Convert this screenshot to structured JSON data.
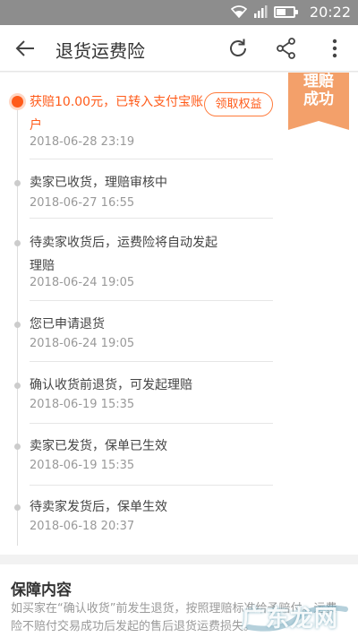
{
  "status_bar": {
    "time": "20:22",
    "battery_level": 0.55
  },
  "header": {
    "title": "退货运费险"
  },
  "ribbon": {
    "line1": "理赔",
    "line2": "成功"
  },
  "timeline": [
    {
      "text": "获赔10.00元，已转入支付宝账户",
      "time": "2018-06-28 23:19",
      "active": true,
      "button_label": "领取权益"
    },
    {
      "text": "卖家已收货，理赔审核中",
      "time": "2018-06-27 16:55"
    },
    {
      "text": "待卖家收货后，运费险将自动发起理赔",
      "time": "2018-06-24 19:05"
    },
    {
      "text": "您已申请退货",
      "time": "2018-06-24 19:05"
    },
    {
      "text": "确认收货前退货，可发起理赔",
      "time": "2018-06-19 15:35"
    },
    {
      "text": "卖家已发货，保单已生效",
      "time": "2018-06-19 15:35"
    },
    {
      "text": "待卖家发货后，保单生效",
      "time": "2018-06-18 20:37"
    }
  ],
  "coverage": {
    "title": "保障内容",
    "body": "如买家在“确认收货”前发生退货，按照理赔标准给予赔付。运费险不赔付交易成功后发起的售后退货运费损失。"
  },
  "watermark": {
    "text": "广东龙网"
  },
  "colors": {
    "accent": "#ff5b1a",
    "ribbon": "#f3a06a",
    "status_bar": "#8d8d8d"
  }
}
